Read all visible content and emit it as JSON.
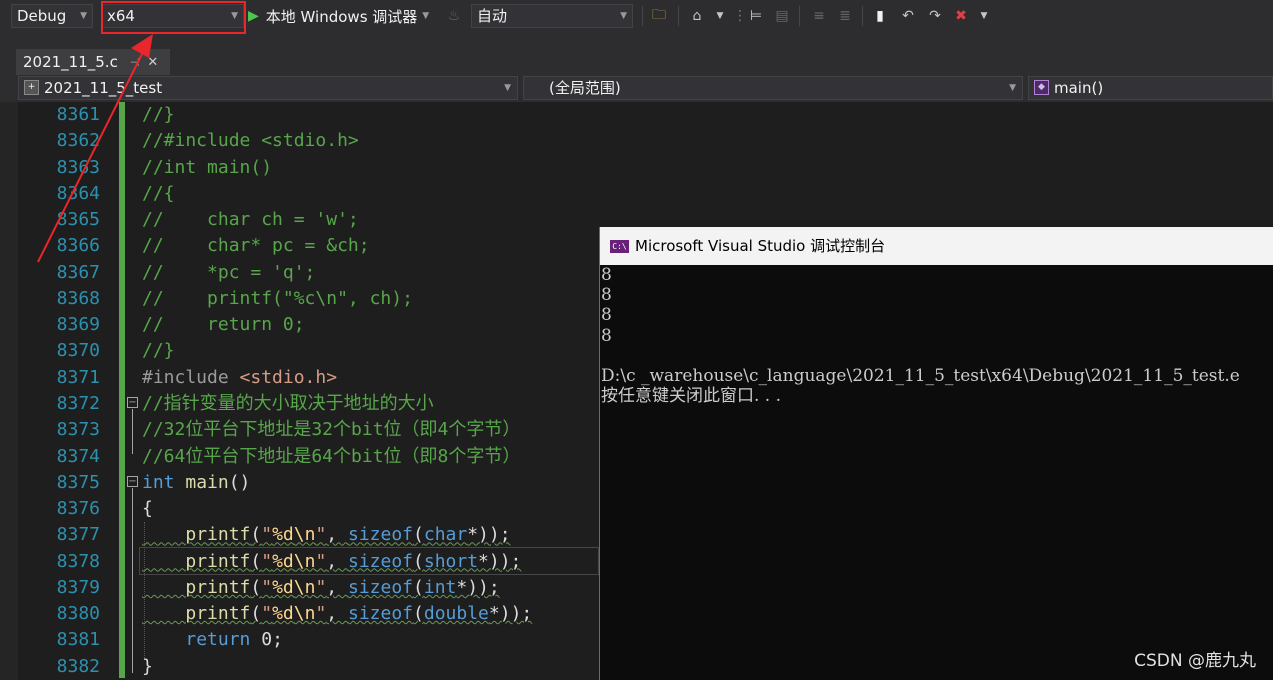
{
  "toolbar": {
    "configuration": "Debug",
    "platform": "x64",
    "run_label": "本地 Windows 调试器",
    "solution_config": "自动",
    "icons": [
      "folder-search-icon",
      "home-icon",
      "step-over-icon",
      "toggle-comment-icon",
      "indent-icon",
      "outdent-icon",
      "bookmark-icon",
      "prev-bookmark-icon",
      "next-bookmark-icon",
      "clear-bookmark-icon"
    ]
  },
  "tab": {
    "title": "2021_11_5.c",
    "pin_glyph": "⊣",
    "close_glyph": "✕"
  },
  "navbar": {
    "project": "2021_11_5_test",
    "scope": "(全局范围)",
    "member": "main()"
  },
  "editor": {
    "lines": [
      {
        "n": "8361",
        "code": "//}"
      },
      {
        "n": "8362",
        "code": "//#include <stdio.h>"
      },
      {
        "n": "8363",
        "code": "//int main()"
      },
      {
        "n": "8364",
        "code": "//{"
      },
      {
        "n": "8365",
        "code": "//    char ch = 'w';"
      },
      {
        "n": "8366",
        "code": "//    char* pc = &ch;"
      },
      {
        "n": "8367",
        "code": "//    *pc = 'q';"
      },
      {
        "n": "8368",
        "code": "//    printf(\"%c\\n\", ch);"
      },
      {
        "n": "8369",
        "code": "//    return 0;"
      },
      {
        "n": "8370",
        "code": "//}"
      },
      {
        "n": "8371",
        "code": "#include <stdio.h>"
      },
      {
        "n": "8372",
        "code": "//指针变量的大小取决于地址的大小"
      },
      {
        "n": "8373",
        "code": "//32位平台下地址是32个bit位（即4个字节）"
      },
      {
        "n": "8374",
        "code": "//64位平台下地址是64个bit位（即8个字节）"
      },
      {
        "n": "8375",
        "code": "int main()"
      },
      {
        "n": "8376",
        "code": "{"
      },
      {
        "n": "8377",
        "code": "    printf(\"%d\\n\", sizeof(char*));"
      },
      {
        "n": "8378",
        "code": "    printf(\"%d\\n\", sizeof(short*));"
      },
      {
        "n": "8379",
        "code": "    printf(\"%d\\n\", sizeof(int*));"
      },
      {
        "n": "8380",
        "code": "    printf(\"%d\\n\", sizeof(double*));"
      },
      {
        "n": "8381",
        "code": "    return 0;"
      },
      {
        "n": "8382",
        "code": "}"
      }
    ]
  },
  "console": {
    "title": "Microsoft Visual Studio 调试控制台",
    "icon_text": "C:\\",
    "output": [
      "8",
      "8",
      "8",
      "8",
      "",
      "D:\\c _warehouse\\c_language\\2021_11_5_test\\x64\\Debug\\2021_11_5_test.e",
      "按任意键关闭此窗口. . ."
    ]
  },
  "watermark": "CSDN @鹿九丸",
  "colors": {
    "annotation": "#e8262b",
    "comment": "#57a64a",
    "keyword": "#569cd6",
    "line_number": "#2b91af"
  }
}
